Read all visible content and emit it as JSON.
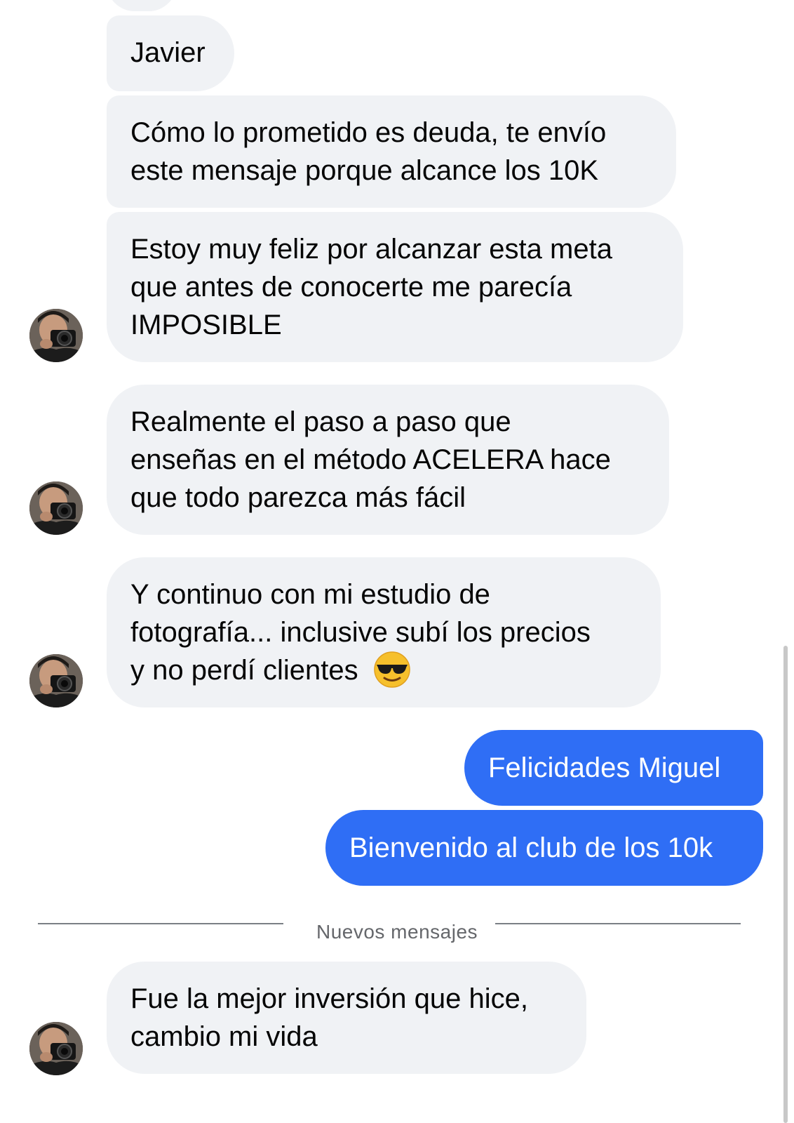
{
  "conversation": {
    "incoming": [
      {
        "lines": [
          "Javier"
        ]
      },
      {
        "lines": [
          "Cómo lo prometido es deuda, te envío",
          "este mensaje porque alcance los 10K"
        ]
      },
      {
        "lines": [
          "Estoy muy feliz por alcanzar esta meta",
          "que antes de conocerte me parecía",
          "IMPOSIBLE"
        ]
      },
      {
        "lines": [
          "Realmente el paso a paso que",
          "enseñas en el método ACELERA hace",
          "que todo parezca más fácil"
        ]
      },
      {
        "lines": [
          "Y continuo con mi estudio de",
          "fotografía... inclusive subí los precios",
          "y no perdí clientes"
        ],
        "emoji": "sunglasses-face"
      }
    ],
    "outgoing": [
      {
        "text": "Felicidades Miguel"
      },
      {
        "text": "Bienvenido al club de los 10k"
      }
    ],
    "divider_label": "Nuevos mensajes",
    "new_messages": [
      {
        "lines": [
          "Fue la mejor inversión que hice,",
          "cambio mi vida"
        ]
      }
    ]
  },
  "colors": {
    "incoming_bubble": "#f0f2f5",
    "outgoing_bubble": "#2f6ef5",
    "divider": "#7b7f85",
    "divider_text": "#65676b"
  },
  "avatar": {
    "icon": "photographer-avatar"
  }
}
